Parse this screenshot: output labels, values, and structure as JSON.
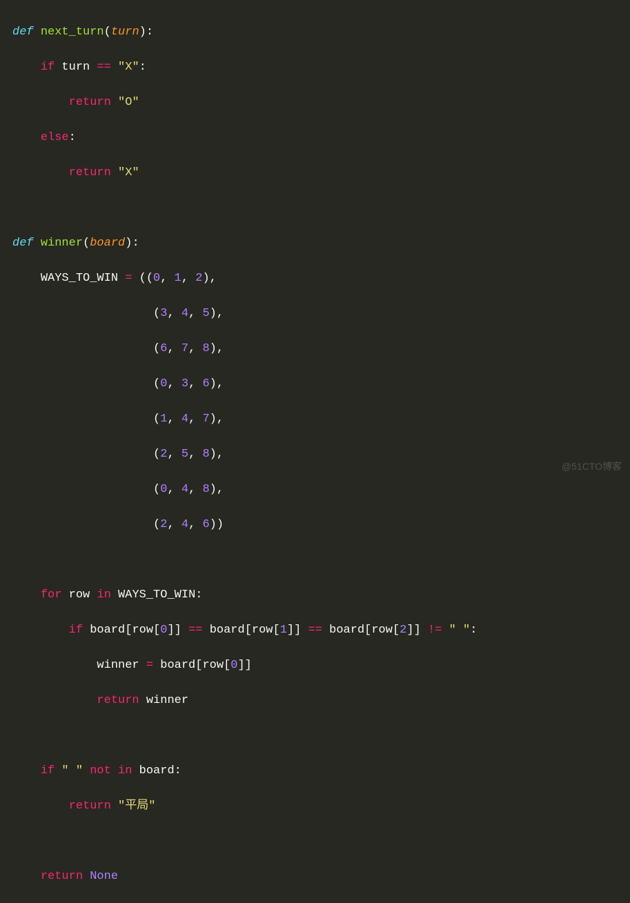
{
  "code": {
    "fn1_def": "def",
    "fn1_name": "next_turn",
    "fn1_param": "turn",
    "fn1_if": "if",
    "fn1_var_turn": "turn",
    "fn1_eq": "==",
    "fn1_x": "\"X\"",
    "fn1_return1": "return",
    "fn1_o": "\"O\"",
    "fn1_else": "else",
    "fn1_return2": "return",
    "fn1_x2": "\"X\"",
    "fn2_def": "def",
    "fn2_name": "winner",
    "fn2_param": "board",
    "waysvar": "WAYS_TO_WIN",
    "assign": "=",
    "t0a": "0",
    "t0b": "1",
    "t0c": "2",
    "t1a": "3",
    "t1b": "4",
    "t1c": "5",
    "t2a": "6",
    "t2b": "7",
    "t2c": "8",
    "t3a": "0",
    "t3b": "3",
    "t3c": "6",
    "t4a": "1",
    "t4b": "4",
    "t4c": "7",
    "t5a": "2",
    "t5b": "5",
    "t5c": "8",
    "t6a": "0",
    "t6b": "4",
    "t6c": "8",
    "t7a": "2",
    "t7b": "4",
    "t7c": "6",
    "for_kw": "for",
    "row_var": "row",
    "in_kw": "in",
    "ways_ref": "WAYS_TO_WIN",
    "if2_kw": "if",
    "board_ref1": "board",
    "row_ref1": "row",
    "idx0": "0",
    "eq1": "==",
    "board_ref2": "board",
    "row_ref2": "row",
    "idx1": "1",
    "eq2": "==",
    "board_ref3": "board",
    "row_ref3": "row",
    "idx2": "2",
    "neq": "!=",
    "space_str": "\" \"",
    "winner_var": "winner",
    "assign2": "=",
    "board_ref4": "board",
    "row_ref4": "row",
    "idx0b": "0",
    "return3": "return",
    "winner_ref": "winner",
    "if3_kw": "if",
    "space_str2": "\" \"",
    "not_kw": "not",
    "in_kw2": "in",
    "board_ref5": "board",
    "return4": "return",
    "tie_str": "\"平局\"",
    "return5": "return",
    "none_kw": "None"
  },
  "watermark": "@51CTO博客"
}
